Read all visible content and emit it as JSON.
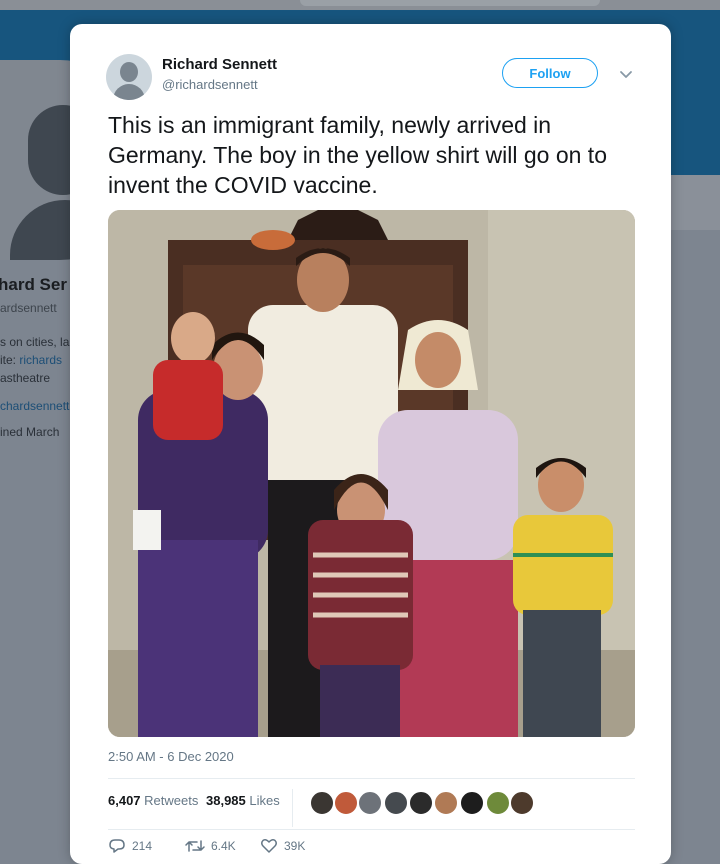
{
  "background_profile": {
    "name_fragment": "hard Ser",
    "handle_fragment": "ardsennett",
    "bio_line1": "s on cities, la",
    "bio_line2_prefix": "ite: ",
    "bio_line2_link": "richards",
    "bio_line3_link": "astheatre",
    "link_line": "chardsennett",
    "joined_fragment": "ined March"
  },
  "tweet": {
    "author_name": "Richard Sennett",
    "author_handle": "@richardsennett",
    "follow_label": "Follow",
    "text": "This is an immigrant family, newly arrived in Germany.  The boy in the yellow shirt will go on to invent the COVID vaccine.",
    "timestamp": "2:50 AM - 6 Dec 2020",
    "retweets_count": "6,407",
    "retweets_label": "Retweets",
    "likes_count": "38,985",
    "likes_label": "Likes",
    "replies_action": "214",
    "retweets_action": "6.4K",
    "likes_action": "39K"
  },
  "icons": {
    "reply": "reply-icon",
    "retweet": "retweet-icon",
    "like": "heart-icon",
    "more": "chevron-down-icon"
  },
  "colors": {
    "accent": "#1da1f2",
    "banner": "#17557e",
    "secondary_text": "#657786"
  }
}
